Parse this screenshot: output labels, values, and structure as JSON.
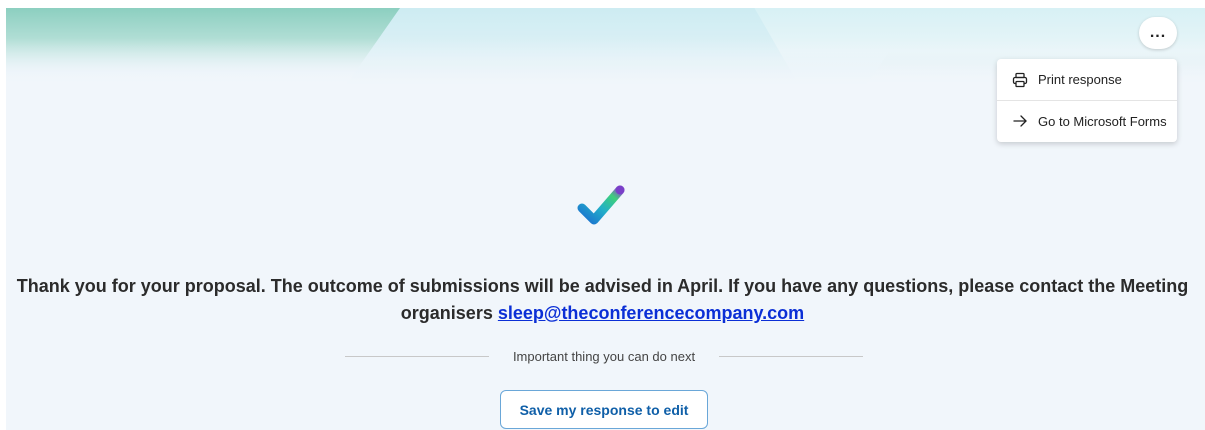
{
  "header": {
    "more_button_label": "..."
  },
  "menu": {
    "items": [
      {
        "label": "Print response",
        "icon": "printer-icon"
      },
      {
        "label": "Go to Microsoft Forms",
        "icon": "arrow-right-icon"
      }
    ]
  },
  "confirmation": {
    "message": "Thank you for your proposal. The outcome of submissions will be advised in April. If you have any questions, please contact the Meeting organisers",
    "email": "sleep@theconferencecompany.com",
    "icon": "checkmark-icon"
  },
  "next_steps": {
    "label": "Important thing you can do next",
    "save_button_label": "Save my response to edit"
  },
  "colors": {
    "accent": "#0f5fa8",
    "link": "#0b2fd6",
    "background": "#f1f6fb"
  }
}
